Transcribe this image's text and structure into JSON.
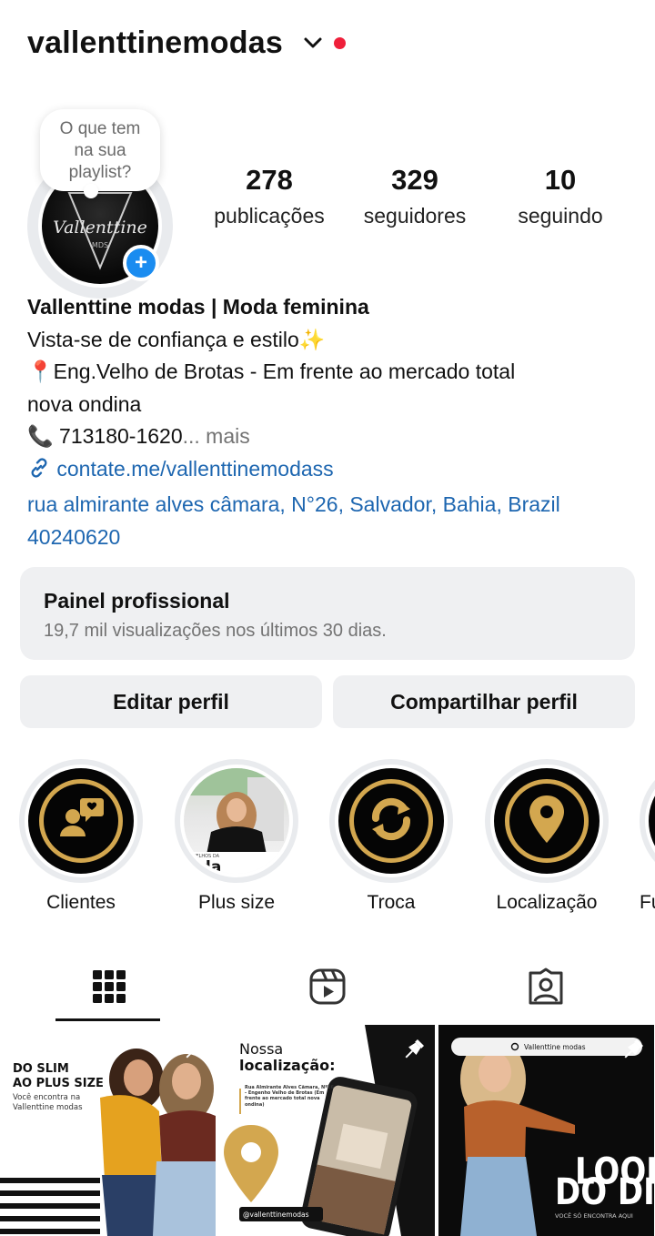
{
  "header": {
    "username": "vallenttinemodas"
  },
  "note": {
    "text": "O que tem na sua playlist?"
  },
  "profile": {
    "avatar_text": "Vallenttine",
    "avatar_sub": "MDS"
  },
  "stats": [
    {
      "value": "278",
      "label": "publicações"
    },
    {
      "value": "329",
      "label": "seguidores"
    },
    {
      "value": "10",
      "label": "seguindo"
    }
  ],
  "bio": {
    "name": "Vallenttine modas | Moda feminina",
    "line1": "Vista-se de confiança e estilo✨",
    "line2": "Eng.Velho de Brotas - Em frente ao mercado total",
    "line3": "nova ondina",
    "phone": "713180-1620",
    "more": "... mais",
    "link": "contate.me/vallenttinemodass",
    "address1": "rua almirante alves câmara, N°26, Salvador, Bahia, Brazil",
    "address2": "40240620"
  },
  "dashboard": {
    "title": "Painel profissional",
    "subtitle": "19,7 mil visualizações nos últimos 30 dias."
  },
  "buttons": {
    "edit": "Editar perfil",
    "share": "Compartilhar perfil"
  },
  "highlights": [
    {
      "label": "Clientes",
      "icon": "person-chat-icon"
    },
    {
      "label": "Plus size",
      "icon": "photo"
    },
    {
      "label": "Troca",
      "icon": "exchange-icon"
    },
    {
      "label": "Localização",
      "icon": "location-pin-icon"
    },
    {
      "label": "Fu",
      "icon": "partial"
    }
  ],
  "highlight_photo_text": "oda",
  "highlight_photo_small": "VELHOS DA",
  "posts": {
    "post1": {
      "title1": "DO SLIM",
      "title2": "AO PLUS SIZE",
      "sub1": "Você encontra na",
      "sub2": "Vallenttine modas"
    },
    "post2": {
      "title1": "Nossa",
      "title2": "localização:",
      "address": "Rua Almirante Alves Câmara, Nº26 - Engenho Velho de Brotas (Em frente ao mercado total nova ondina)",
      "handle": "@vallenttinemodas"
    },
    "post3": {
      "search": "Vallenttine modas",
      "look": "LOOK",
      "dodia": "DO DIA",
      "sub": "VOCÊ SÓ ENCONTRA AQUI"
    }
  },
  "colors": {
    "accent_gold": "#d3a74f",
    "link_blue": "#1d66b0",
    "add_blue": "#1a8cf0",
    "red_dot": "#ef1f3a"
  }
}
